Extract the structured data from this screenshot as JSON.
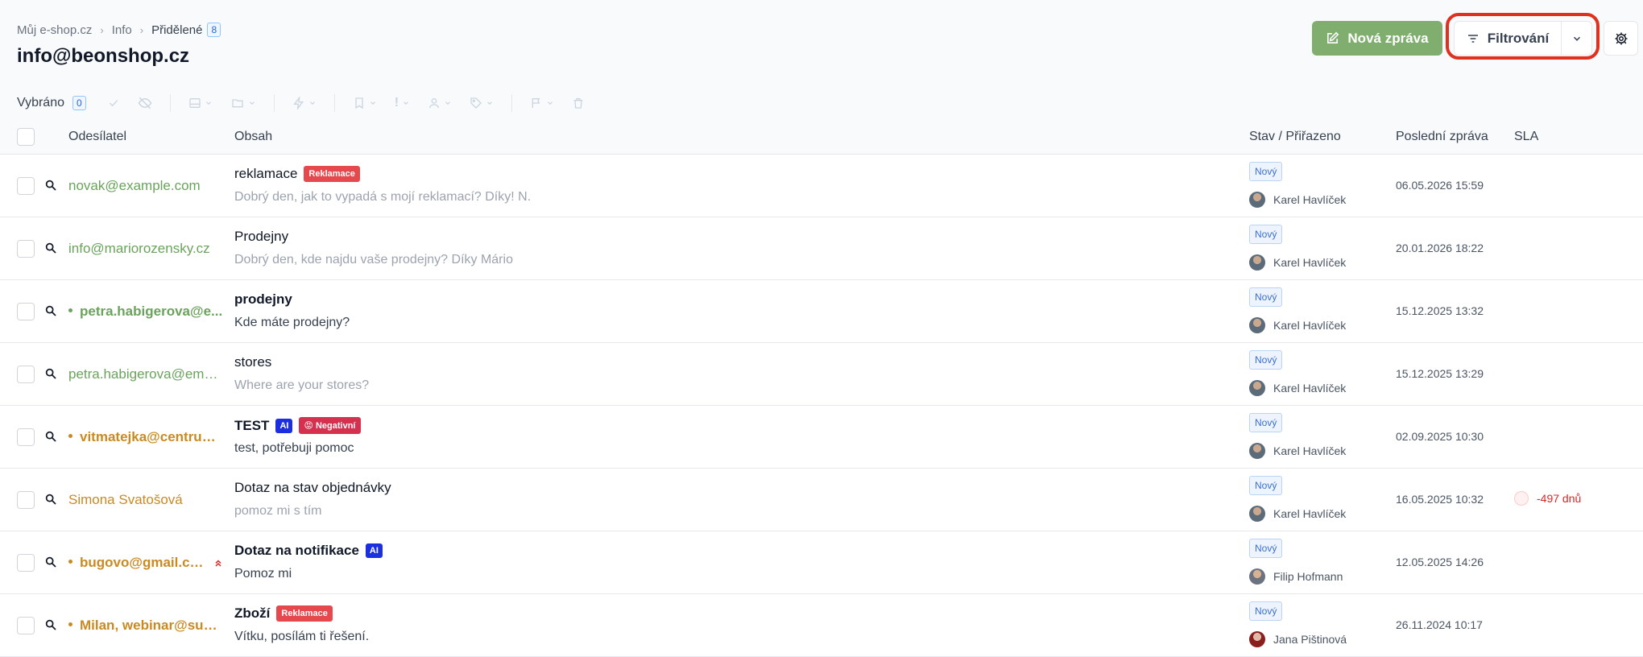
{
  "breadcrumb": {
    "items": [
      "Můj e-shop.cz",
      "Info",
      "Přidělené"
    ],
    "count": "8"
  },
  "page_title": "info@beonshop.cz",
  "header_actions": {
    "new_message": "Nová zpráva",
    "filter": "Filtrování"
  },
  "toolbar": {
    "selected_label": "Vybráno",
    "selected_count": "0"
  },
  "columns": {
    "sender": "Odesílatel",
    "content": "Obsah",
    "status": "Stav / Přiřazeno",
    "last_message": "Poslední zpráva",
    "sla": "SLA"
  },
  "rows": [
    {
      "sender": "novak@example.com",
      "subject": "reklamace",
      "preview": "Dobrý den, jak to vypadá s mojí reklamací? Díky! N.",
      "status": "Nový",
      "assignee": "Karel Havlíček",
      "date": "06.05.2026 15:59",
      "tags": [
        "Reklamace"
      ]
    },
    {
      "sender": "info@mariorozensky.cz",
      "subject": "Prodejny",
      "preview": "Dobrý den, kde najdu vaše prodejny? Díky Mário",
      "status": "Nový",
      "assignee": "Karel Havlíček",
      "date": "20.01.2026 18:22"
    },
    {
      "sender": "petra.habigerova@e...",
      "subject": "prodejny",
      "preview": "Kde máte prodejny?",
      "status": "Nový",
      "assignee": "Karel Havlíček",
      "date": "15.12.2025 13:32"
    },
    {
      "sender": "petra.habigerova@emai...",
      "subject": "stores",
      "preview": "Where are your stores?",
      "status": "Nový",
      "assignee": "Karel Havlíček",
      "date": "15.12.2025 13:29"
    },
    {
      "sender": "vitmatejka@centrum...",
      "subject": "TEST",
      "preview": "test, potřebuji pomoc",
      "status": "Nový",
      "assignee": "Karel Havlíček",
      "date": "02.09.2025 10:30",
      "tags": [
        "AI",
        "😡 Negativní"
      ]
    },
    {
      "sender": "Simona Svatošová",
      "subject": "Dotaz na stav objednávky",
      "preview": "pomoz mi s tím",
      "status": "Nový",
      "assignee": "Karel Havlíček",
      "date": "16.05.2025 10:32",
      "sla": "-497 dnů"
    },
    {
      "sender": "bugovo@gmail.cm...",
      "subject": "Dotaz na notifikace",
      "preview": "Pomoz mi",
      "status": "Nový",
      "assignee": "Filip Hofmann",
      "date": "12.05.2025 14:26",
      "tags": [
        "AI"
      ]
    },
    {
      "sender": "Milan, webinar@sup...",
      "subject": "Zboží",
      "preview": "Vítku, posílám ti řešení.",
      "status": "Nový",
      "assignee": "Jana Pištinová",
      "date": "26.11.2024 10:17",
      "tags": [
        "Reklamace"
      ]
    }
  ],
  "icons": [
    "filter-icon",
    "chevron-down-icon",
    "gear-icon",
    "edit-icon",
    "search-icon",
    "check-icon",
    "eye-off-icon",
    "archive-icon",
    "folder-icon",
    "bolt-icon",
    "bookmark-icon",
    "priority-icon",
    "user-icon",
    "tag-icon",
    "flag-icon",
    "trash-icon",
    "double-chevron-up-icon"
  ]
}
